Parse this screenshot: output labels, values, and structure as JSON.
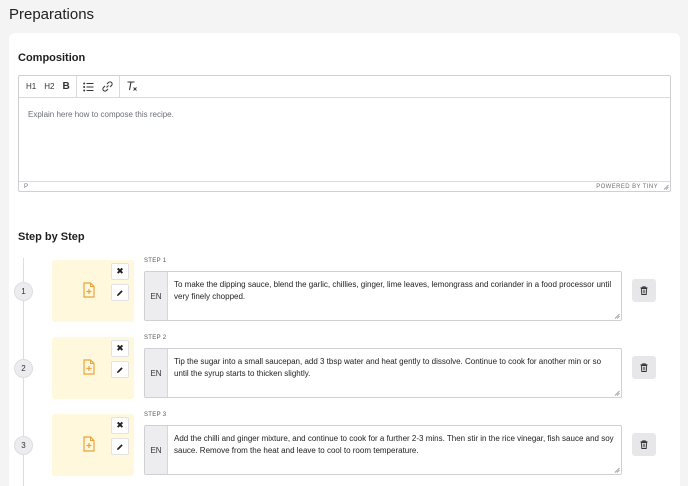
{
  "page": {
    "title": "Preparations"
  },
  "composition": {
    "title": "Composition",
    "toolbar": {
      "h1": "H1",
      "h2": "H2",
      "bold": "B"
    },
    "placeholder": "Explain here how to compose this recipe.",
    "status_path": "P",
    "powered_by": "POWERED BY TINY"
  },
  "steps_section": {
    "title": "Step by Step",
    "steps": [
      {
        "number": "1",
        "label": "STEP 1",
        "lang": "EN",
        "text": "To make the dipping sauce, blend the garlic, chillies, ginger, lime leaves, lemongrass and coriander in a food processor until very finely chopped."
      },
      {
        "number": "2",
        "label": "STEP 2",
        "lang": "EN",
        "text": "Tip the sugar into a small saucepan, add 3 tbsp water and heat gently to dissolve. Continue to cook for another min or so until the syrup starts to thicken slightly."
      },
      {
        "number": "3",
        "label": "STEP 3",
        "lang": "EN",
        "text": "Add the chilli and ginger mixture, and continue to cook for a further 2-3 mins. Then stir in the rice vinegar, fish sauce and soy sauce. Remove from the heat and leave to cool to room temperature."
      }
    ]
  },
  "icons": {
    "bullet_list": "bullet-list-icon",
    "link": "link-icon",
    "clear_format": "clear-format-icon",
    "add_media": "add-file-icon",
    "close": "close-icon",
    "edit": "pencil-icon",
    "delete": "trash-icon"
  },
  "colors": {
    "media_bg": "#fff8dc",
    "media_icon": "#e8a33d",
    "page_bg": "#f4f4f5"
  }
}
